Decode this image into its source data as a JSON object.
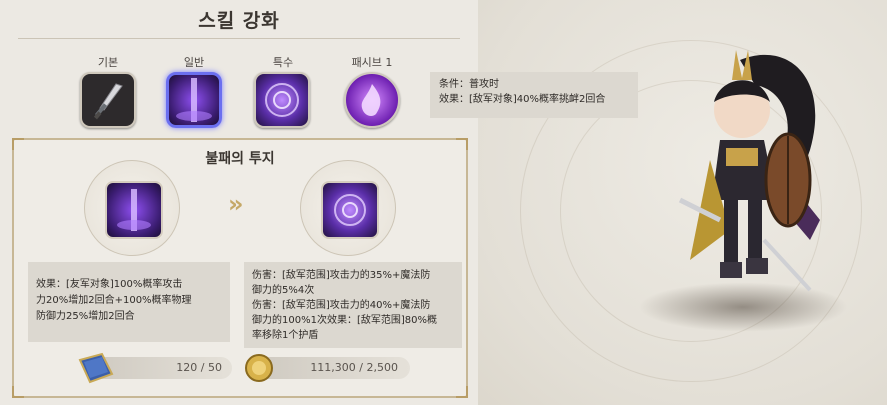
{
  "header": {
    "title": "스킬 강화"
  },
  "tabs": [
    {
      "label": "기본",
      "icon": "sword-icon"
    },
    {
      "label": "일반",
      "icon": "purple-portal-icon",
      "selected": true
    },
    {
      "label": "특수",
      "icon": "purple-vortex-icon"
    },
    {
      "label": "패시브 1",
      "icon": "purple-flame-icon"
    }
  ],
  "tooltip": {
    "line1": "条件：普攻时",
    "line2": "效果：[敌军对象]40%概率挑衅2回合"
  },
  "detail": {
    "title": "불패의 투지",
    "target_label": "특수",
    "current_desc": [
      "效果：[友军对象]100%概率攻击",
      "力20%增加2回合+100%概率物理",
      "防御力25%增加2回合"
    ],
    "target_desc": [
      "伤害：[敌军范围]攻击力的35%+魔法防",
      "御力的5%4次",
      "伤害：[敌军范围]攻击力的40%+魔法防",
      "御力的100%1次效果：[敌军范围]80%概",
      "率移除1个护盾"
    ]
  },
  "costs": {
    "book": {
      "icon": "blue-book-icon",
      "value": "120 / 50"
    },
    "gold": {
      "icon": "gold-coin-icon",
      "value": "111,300 / 2,500"
    }
  },
  "colors": {
    "accent": "#6b6ff0",
    "gold": "#c5a867",
    "panel": "#ece9e3"
  }
}
